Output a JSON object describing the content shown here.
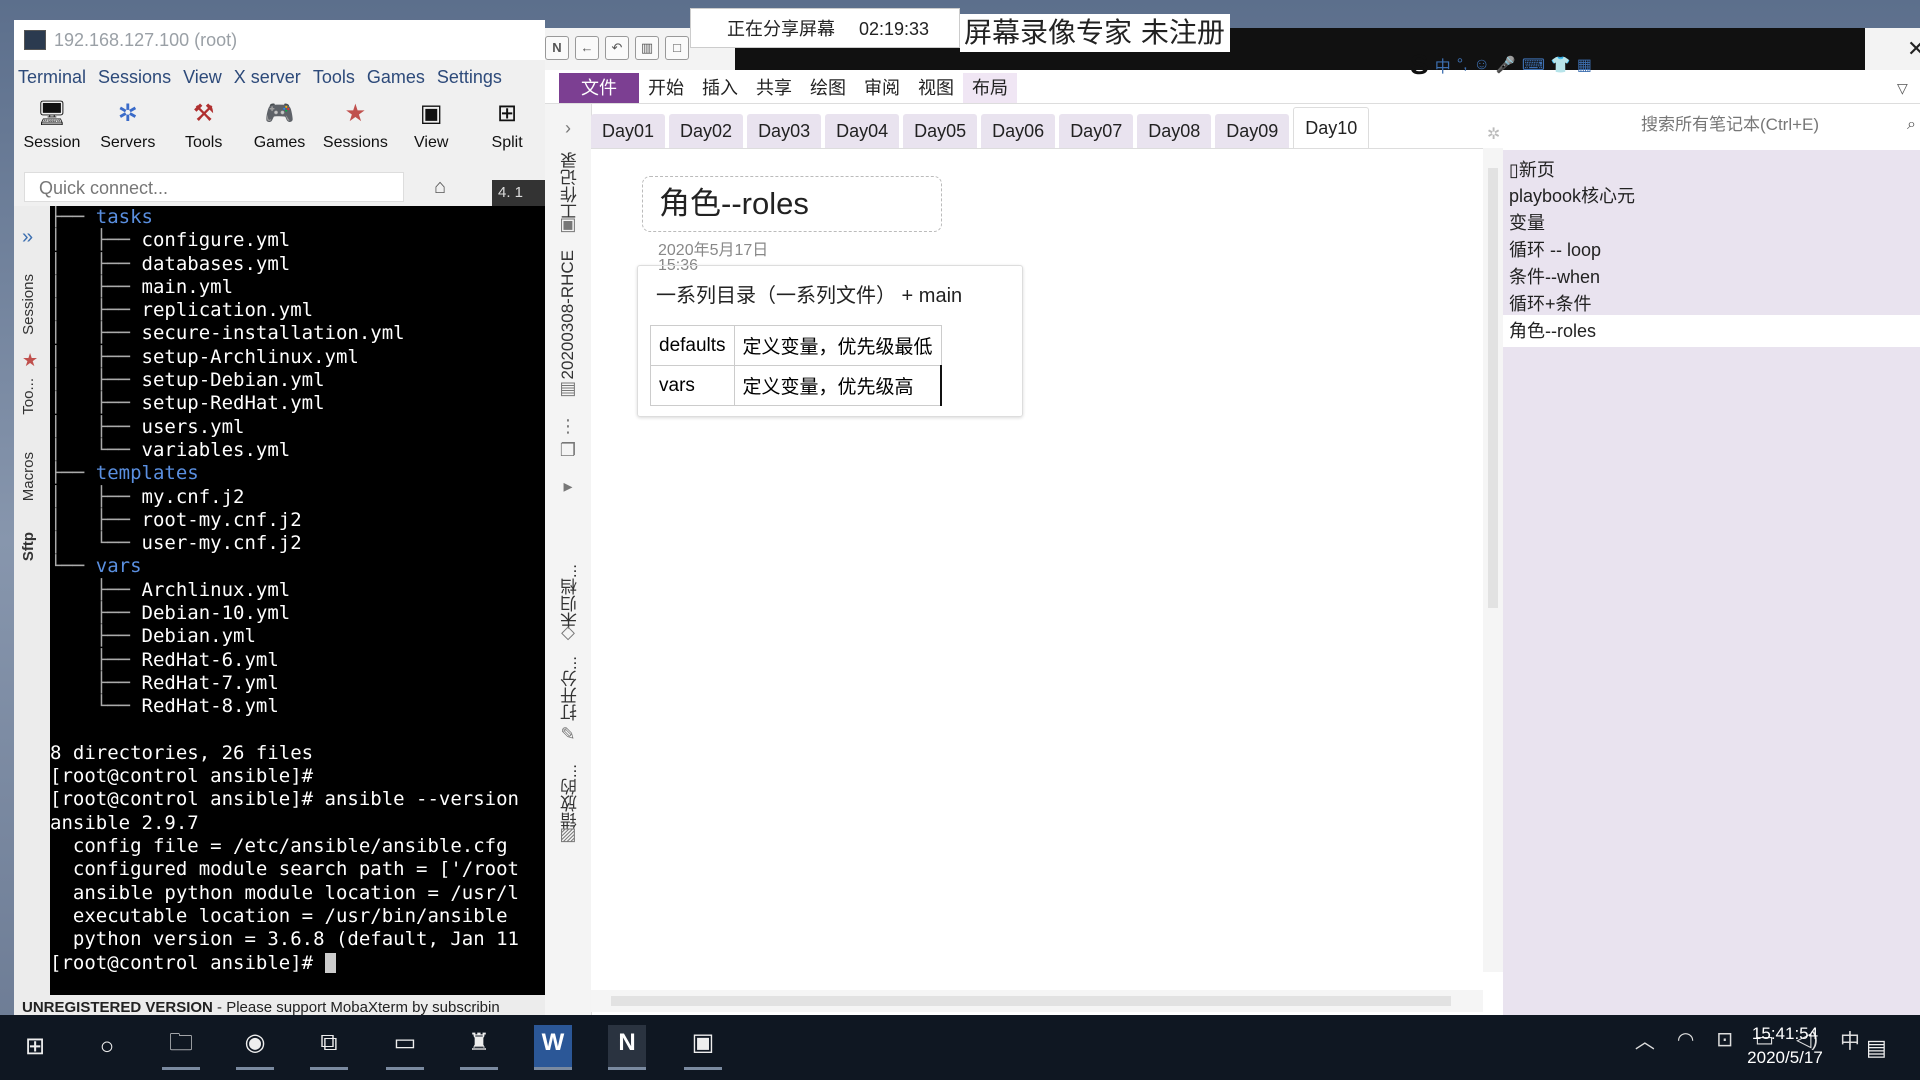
{
  "mobaxterm": {
    "title": "192.168.127.100 (root)",
    "menu": [
      "Terminal",
      "Sessions",
      "View",
      "X server",
      "Tools",
      "Games",
      "Settings"
    ],
    "toolbar": [
      {
        "label": "Session",
        "icon": "monitor-icon"
      },
      {
        "label": "Servers",
        "icon": "servers-icon"
      },
      {
        "label": "Tools",
        "icon": "tools-icon"
      },
      {
        "label": "Games",
        "icon": "games-icon"
      },
      {
        "label": "Sessions",
        "icon": "star-icon"
      },
      {
        "label": "View",
        "icon": "view-icon"
      },
      {
        "label": "Split",
        "icon": "split-icon"
      }
    ],
    "quick_connect_placeholder": "Quick connect...",
    "session_tab": "4. 1",
    "side_tabs": [
      "Sessions",
      "Too...",
      "Macros",
      "Sftp"
    ],
    "terminal_lines": [
      {
        "t": "├── ",
        "k": "tree",
        "n": "tasks",
        "nk": "dir",
        "indent": ""
      },
      {
        "t": "│   ├── ",
        "k": "tree",
        "n": "configure.yml"
      },
      {
        "t": "│   ├── ",
        "k": "tree",
        "n": "databases.yml"
      },
      {
        "t": "│   ├── ",
        "k": "tree",
        "n": "main.yml"
      },
      {
        "t": "│   ├── ",
        "k": "tree",
        "n": "replication.yml"
      },
      {
        "t": "│   ├── ",
        "k": "tree",
        "n": "secure-installation.yml"
      },
      {
        "t": "│   ├── ",
        "k": "tree",
        "n": "setup-Archlinux.yml"
      },
      {
        "t": "│   ├── ",
        "k": "tree",
        "n": "setup-Debian.yml"
      },
      {
        "t": "│   ├── ",
        "k": "tree",
        "n": "setup-RedHat.yml"
      },
      {
        "t": "│   ├── ",
        "k": "tree",
        "n": "users.yml"
      },
      {
        "t": "│   └── ",
        "k": "tree",
        "n": "variables.yml"
      },
      {
        "t": "├── ",
        "k": "tree",
        "n": "templates",
        "nk": "dir"
      },
      {
        "t": "│   ├── ",
        "k": "tree",
        "n": "my.cnf.j2"
      },
      {
        "t": "│   ├── ",
        "k": "tree",
        "n": "root-my.cnf.j2"
      },
      {
        "t": "│   └── ",
        "k": "tree",
        "n": "user-my.cnf.j2"
      },
      {
        "t": "└── ",
        "k": "tree",
        "n": "vars",
        "nk": "dir"
      },
      {
        "t": "    ├── ",
        "k": "tree",
        "n": "Archlinux.yml"
      },
      {
        "t": "    ├── ",
        "k": "tree",
        "n": "Debian-10.yml"
      },
      {
        "t": "    ├── ",
        "k": "tree",
        "n": "Debian.yml"
      },
      {
        "t": "    ├── ",
        "k": "tree",
        "n": "RedHat-6.yml"
      },
      {
        "t": "    ├── ",
        "k": "tree",
        "n": "RedHat-7.yml"
      },
      {
        "t": "    └── ",
        "k": "tree",
        "n": "RedHat-8.yml"
      },
      {
        "t": "",
        "n": ""
      },
      {
        "t": "",
        "n": "8 directories, 26 files"
      },
      {
        "t": "",
        "n": "[root@control ansible]#"
      },
      {
        "t": "",
        "n": "[root@control ansible]# ansible --version"
      },
      {
        "t": "",
        "n": "ansible 2.9.7"
      },
      {
        "t": "",
        "n": "  config file = /etc/ansible/ansible.cfg"
      },
      {
        "t": "",
        "n": "  configured module search path = ['/root"
      },
      {
        "t": "",
        "n": "  ansible python module location = /usr/l"
      },
      {
        "t": "",
        "n": "  executable location = /usr/bin/ansible"
      },
      {
        "t": "",
        "n": "  python version = 3.6.8 (default, Jan 11"
      },
      {
        "t": "",
        "n": "[root@control ansible]# ",
        "cursor": true
      }
    ],
    "status_bold": "UNREGISTERED VERSION",
    "status_text": " -  Please support MobaXterm by subscribin"
  },
  "share_bar": {
    "text": "正在分享屏幕",
    "time": "02:19:33"
  },
  "watermark": "屏幕录像专家  未注册",
  "onenote": {
    "ribbon_tabs": [
      "文件",
      "开始",
      "插入",
      "共享",
      "绘图",
      "审阅",
      "视图",
      "布局"
    ],
    "section_tabs": [
      "Day01",
      "Day02",
      "Day03",
      "Day04",
      "Day05",
      "Day06",
      "Day07",
      "Day08",
      "Day09",
      "Day10"
    ],
    "active_section": "Day10",
    "search_placeholder": "搜索所有笔记本(Ctrl+E)",
    "nav_labels": [
      "工作记录",
      "20200308-RHCE",
      "未归档...",
      "打开分...",
      "错放的..."
    ],
    "page": {
      "title": "角色--roles",
      "date": "2020年5月17日",
      "time": "15:36",
      "line": "一系列目录（一系列文件） +  main",
      "table": [
        [
          "defaults",
          "定义变量，优先级最低"
        ],
        [
          "vars",
          "定义变量，优先级高"
        ]
      ]
    },
    "pages": [
      "新页",
      "playbook核心元",
      "变量",
      "循环 -- loop",
      "条件--when",
      "循环+条件",
      "角色--roles"
    ],
    "selected_page": "角色--roles"
  },
  "ime": {
    "lang": "中"
  },
  "taskbar": {
    "clock_time": "15:41:54",
    "clock_date": "2020/5/17",
    "ime": "中"
  }
}
